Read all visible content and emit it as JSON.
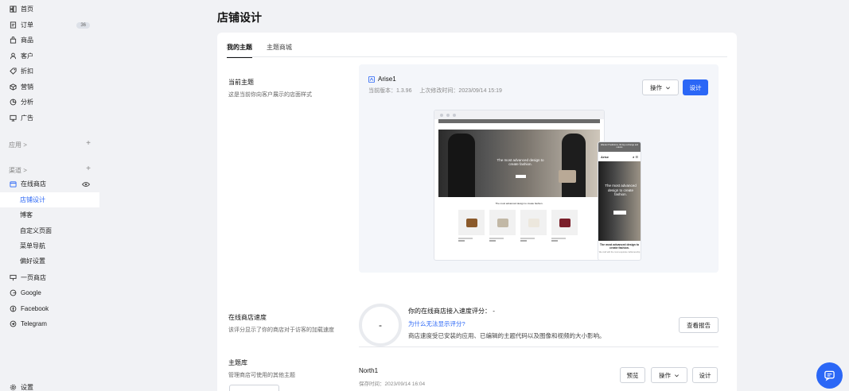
{
  "sidebar": {
    "items": [
      {
        "label": "首页",
        "icon": "home-icon"
      },
      {
        "label": "订单",
        "icon": "orders-icon",
        "badge": "36"
      },
      {
        "label": "商品",
        "icon": "bag-icon"
      },
      {
        "label": "客户",
        "icon": "user-icon"
      },
      {
        "label": "折扣",
        "icon": "tag-icon"
      },
      {
        "label": "营销",
        "icon": "marketing-icon"
      },
      {
        "label": "分析",
        "icon": "analytics-icon"
      },
      {
        "label": "广告",
        "icon": "ads-icon"
      }
    ],
    "apps_label": "应用 >",
    "channels_label": "渠道 >",
    "online_store": {
      "label": "在线商店",
      "icon": "store-icon"
    },
    "online_store_subitems": [
      "店铺设计",
      "博客",
      "自定义页面",
      "菜单导航",
      "偏好设置"
    ],
    "channels": [
      {
        "label": "一页商店",
        "icon": "one-page-icon"
      },
      {
        "label": "Google",
        "icon": "google-icon"
      },
      {
        "label": "Facebook",
        "icon": "facebook-icon"
      },
      {
        "label": "Telegram",
        "icon": "telegram-icon"
      }
    ],
    "settings": {
      "label": "设置",
      "icon": "gear-icon"
    }
  },
  "page": {
    "title": "店铺设计"
  },
  "tabs": [
    {
      "label": "我的主题",
      "active": true
    },
    {
      "label": "主题商城",
      "active": false
    }
  ],
  "current_theme": {
    "section_title": "当前主题",
    "section_desc": "这是当前你向客户展示的店面样式",
    "name": "Arise1",
    "version": "当前版本：1.3.96",
    "modified": "上次修改时间：2023/09/14 15:19",
    "actions_label": "操作",
    "design_label": "设计",
    "preview": {
      "hero_text": "The most advanced design to create fashion.",
      "caption": "The most advanced design to create fashion.",
      "mobile_promo": "Wander Predictions, 30 day exchange and returns",
      "mobile_brand": "Arise",
      "mobile_hero_text": "The most advanced design to create fashion.",
      "mobile_caption": "The most advanced design to create fashion.",
      "mobile_caption2": "We craft with the most exquisite craftsmanship",
      "bag_colors": [
        "#8b5a2b",
        "#c2b8a6",
        "#ece7dd",
        "#7a1f2a"
      ]
    }
  },
  "speed": {
    "section_title": "在线商店速度",
    "section_desc": "该评分显示了你的商店对于访客的加载速度",
    "score": "-",
    "line1": "你的在线商店接入速度评分： -",
    "link": "为什么无法显示评分?",
    "desc": "商店速度受已安装的应用、已编辑的主题代码以及图像和视频的大小影响。",
    "report_label": "查看报告"
  },
  "library": {
    "section_title": "主题库",
    "section_desc": "管理商店可使用的其他主题",
    "theme_name": "North1",
    "theme_meta": "保存时间：2023/09/14 16:04",
    "preview_label": "预览",
    "actions_label": "操作",
    "design_label": "设计"
  },
  "colors": {
    "accent": "#2b67f6"
  }
}
